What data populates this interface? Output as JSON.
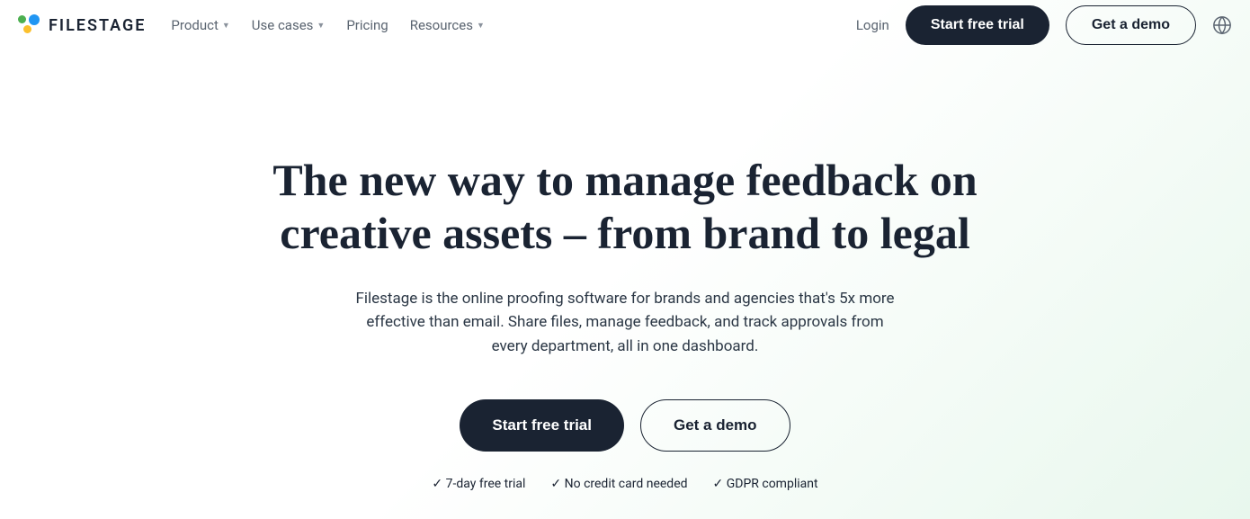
{
  "brand": {
    "name": "FILESTAGE"
  },
  "nav": {
    "items": [
      {
        "label": "Product",
        "has_dropdown": true
      },
      {
        "label": "Use cases",
        "has_dropdown": true
      },
      {
        "label": "Pricing",
        "has_dropdown": false
      },
      {
        "label": "Resources",
        "has_dropdown": true
      }
    ]
  },
  "header_actions": {
    "login": "Login",
    "trial": "Start free trial",
    "demo": "Get a demo"
  },
  "hero": {
    "title": "The new way to manage feedback on creative assets – from brand to legal",
    "subtitle": "Filestage is the online proofing software for brands and agencies that's 5x more effective than email. Share files, manage feedback, and track approvals from every department, all in one dashboard.",
    "cta_primary": "Start free trial",
    "cta_secondary": "Get a demo",
    "bullets": [
      "7-day free trial",
      "No credit card needed",
      "GDPR compliant"
    ]
  }
}
